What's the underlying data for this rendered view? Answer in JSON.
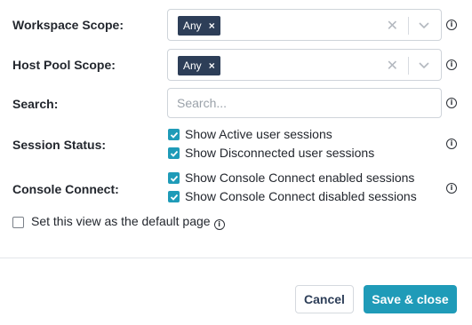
{
  "workspace_scope": {
    "label": "Workspace Scope:",
    "tag": "Any",
    "tag_remove": "×",
    "clear": "✕"
  },
  "host_pool_scope": {
    "label": "Host Pool Scope:",
    "tag": "Any",
    "tag_remove": "×",
    "clear": "✕"
  },
  "search": {
    "label": "Search:",
    "placeholder": "Search...",
    "value": ""
  },
  "session_status": {
    "label": "Session Status:",
    "options": [
      {
        "label": "Show Active user sessions",
        "checked": true
      },
      {
        "label": "Show Disconnected user sessions",
        "checked": true
      }
    ]
  },
  "console_connect": {
    "label": "Console Connect:",
    "options": [
      {
        "label": "Show Console Connect enabled sessions",
        "checked": true
      },
      {
        "label": "Show Console Connect disabled sessions",
        "checked": true
      }
    ]
  },
  "default_page": {
    "label": "Set this view as the default page",
    "checked": false
  },
  "info_glyph": "i",
  "buttons": {
    "cancel": "Cancel",
    "save": "Save & close"
  },
  "colors": {
    "accent": "#1f9bb8",
    "tag_bg": "#2d3e58",
    "border": "#cfd4da"
  },
  "icons": [
    "info-icon",
    "close-icon",
    "chevron-down-icon",
    "check-icon"
  ]
}
